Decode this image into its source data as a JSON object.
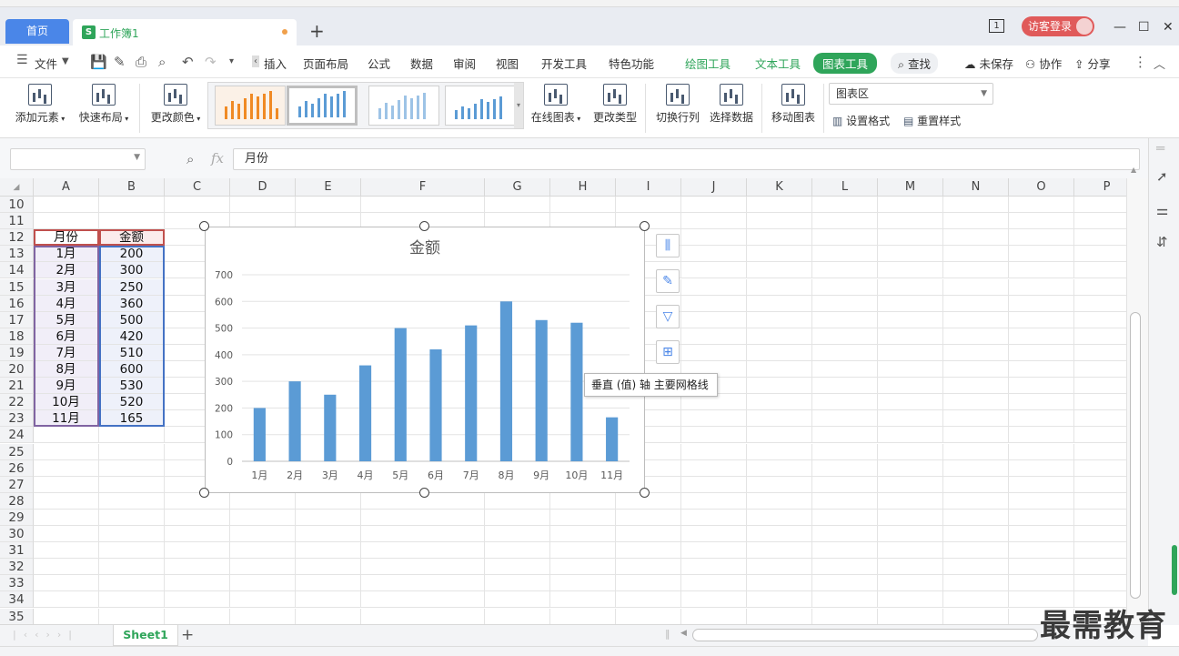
{
  "tabs": {
    "home": "首页",
    "workbook": "工作簿1",
    "new_tab": "+"
  },
  "title_bar": {
    "badge": "1",
    "login": "访客登录",
    "minimize": "—",
    "maximize": "☐",
    "close": "✕"
  },
  "menu": {
    "file": "文件",
    "items": [
      "插入",
      "页面布局",
      "公式",
      "数据",
      "审阅",
      "视图",
      "开发工具",
      "特色功能"
    ],
    "context_items": [
      "绘图工具",
      "文本工具"
    ],
    "active": "图表工具",
    "search": "查找",
    "right": [
      "未保存",
      "协作",
      "分享"
    ]
  },
  "ribbon": {
    "add_element": "添加元素",
    "quick_layout": "快速布局",
    "change_color": "更改颜色",
    "online_chart": "在线图表",
    "change_type": "更改类型",
    "switch_row_col": "切换行列",
    "select_data": "选择数据",
    "move_chart": "移动图表",
    "chart_area": "图表区",
    "set_format": "设置格式",
    "reset_style": "重置样式"
  },
  "formula_bar": {
    "name_box": "",
    "fx": "fx",
    "value": "月份"
  },
  "columns": [
    "A",
    "B",
    "C",
    "D",
    "E",
    "F",
    "G",
    "H",
    "I",
    "J",
    "K",
    "L",
    "M",
    "N",
    "O",
    "P"
  ],
  "rows": [
    "10",
    "11",
    "12",
    "13",
    "14",
    "15",
    "16",
    "17",
    "18",
    "19",
    "20",
    "21",
    "22",
    "23",
    "24",
    "25",
    "26",
    "27",
    "28",
    "29",
    "30",
    "31",
    "32",
    "33",
    "34",
    "35"
  ],
  "table": {
    "header": [
      "月份",
      "金额"
    ],
    "months": [
      "1月",
      "2月",
      "3月",
      "4月",
      "5月",
      "6月",
      "7月",
      "8月",
      "9月",
      "10月",
      "11月"
    ],
    "amounts": [
      "200",
      "300",
      "250",
      "360",
      "500",
      "420",
      "510",
      "600",
      "530",
      "520",
      "165"
    ]
  },
  "chart_data": {
    "type": "bar",
    "title": "金额",
    "categories": [
      "1月",
      "2月",
      "3月",
      "4月",
      "5月",
      "6月",
      "7月",
      "8月",
      "9月",
      "10月",
      "11月"
    ],
    "values": [
      200,
      300,
      250,
      360,
      500,
      420,
      510,
      600,
      530,
      520,
      165
    ],
    "ylim": [
      0,
      700
    ],
    "yticks": [
      "0",
      "100",
      "200",
      "300",
      "400",
      "500",
      "600",
      "700"
    ],
    "xlabel": "",
    "ylabel": "",
    "grid": true,
    "legend": "none",
    "bar_color": "#5b9bd5"
  },
  "tooltip": "垂直 (值) 轴 主要网格线",
  "sheet": {
    "name": "Sheet1",
    "add": "+"
  },
  "watermark": "最需教育",
  "colors": {
    "accent_green": "#2fa55a",
    "tab_blue": "#4a86e8",
    "login_red": "#e05a5a"
  }
}
